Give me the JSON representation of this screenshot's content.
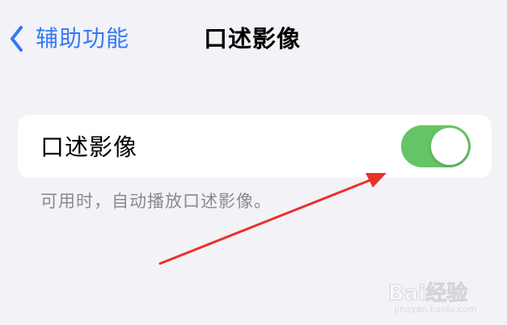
{
  "nav": {
    "back_label": "辅助功能",
    "title": "口述影像"
  },
  "settings": {
    "row_label": "口述影像",
    "toggle_on": true,
    "toggle_color": "#65c466",
    "footnote": "可用时，自动播放口述影像。"
  },
  "colors": {
    "accent": "#3478f6",
    "background": "#f2f2f7",
    "annotation_arrow": "#e8312b"
  },
  "watermark": {
    "brand": "Bai经验",
    "url": "jingyan.baidu.com"
  }
}
